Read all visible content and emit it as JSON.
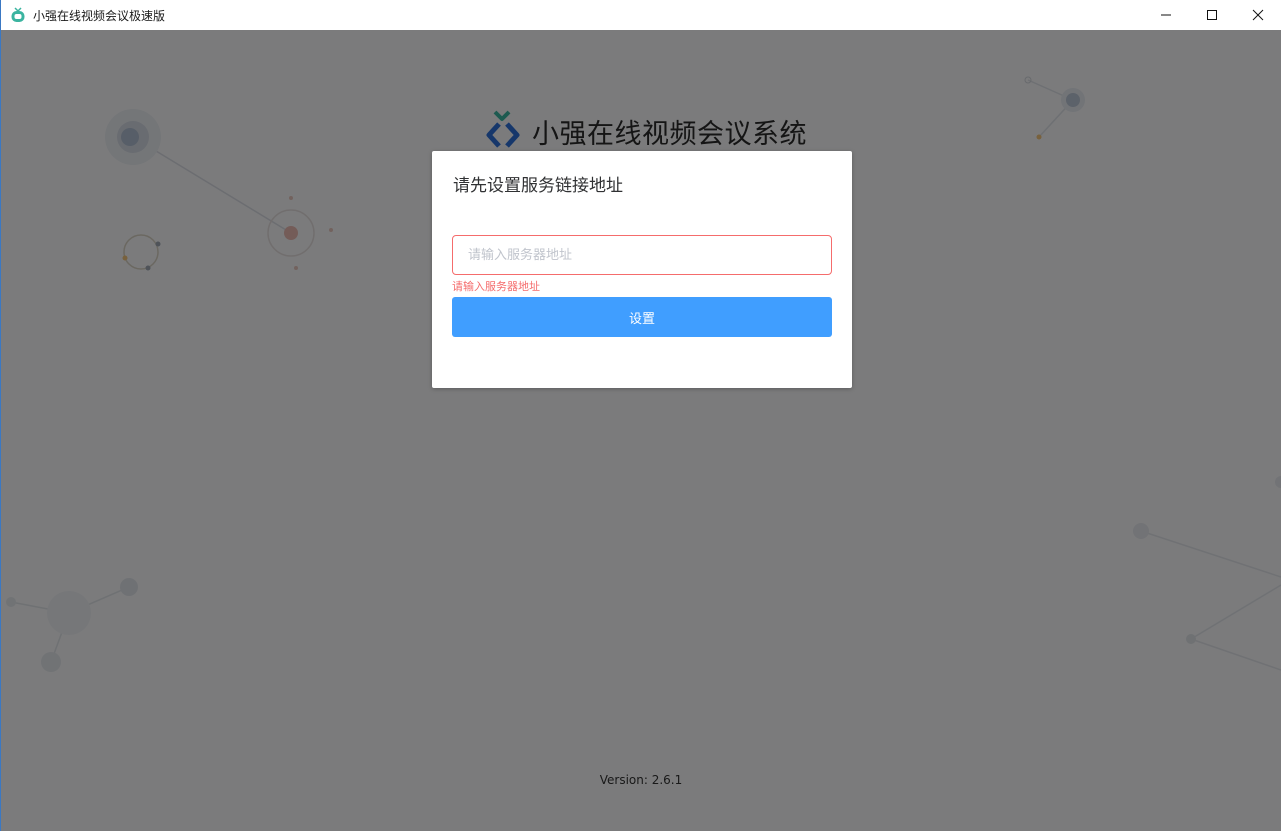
{
  "window": {
    "title": "小强在线视频会议极速版"
  },
  "brand": {
    "title": "小强在线视频会议系统"
  },
  "dialog": {
    "title": "请先设置服务链接地址",
    "input_placeholder": "请输入服务器地址",
    "input_value": "",
    "error_message": "请输入服务器地址",
    "set_button_label": "设置"
  },
  "footer": {
    "version": "Version: 2.6.1"
  },
  "colors": {
    "primary": "#409eff",
    "error": "#f56c6c",
    "logo_green": "#3bb4a0",
    "logo_blue": "#2d6fd6",
    "overlay": "rgba(0,0,0,0.5)"
  },
  "icons": {
    "app": "app-tv-icon",
    "minimize": "minimize-icon",
    "maximize": "maximize-icon",
    "close": "close-icon",
    "logo": "logo-icon"
  }
}
